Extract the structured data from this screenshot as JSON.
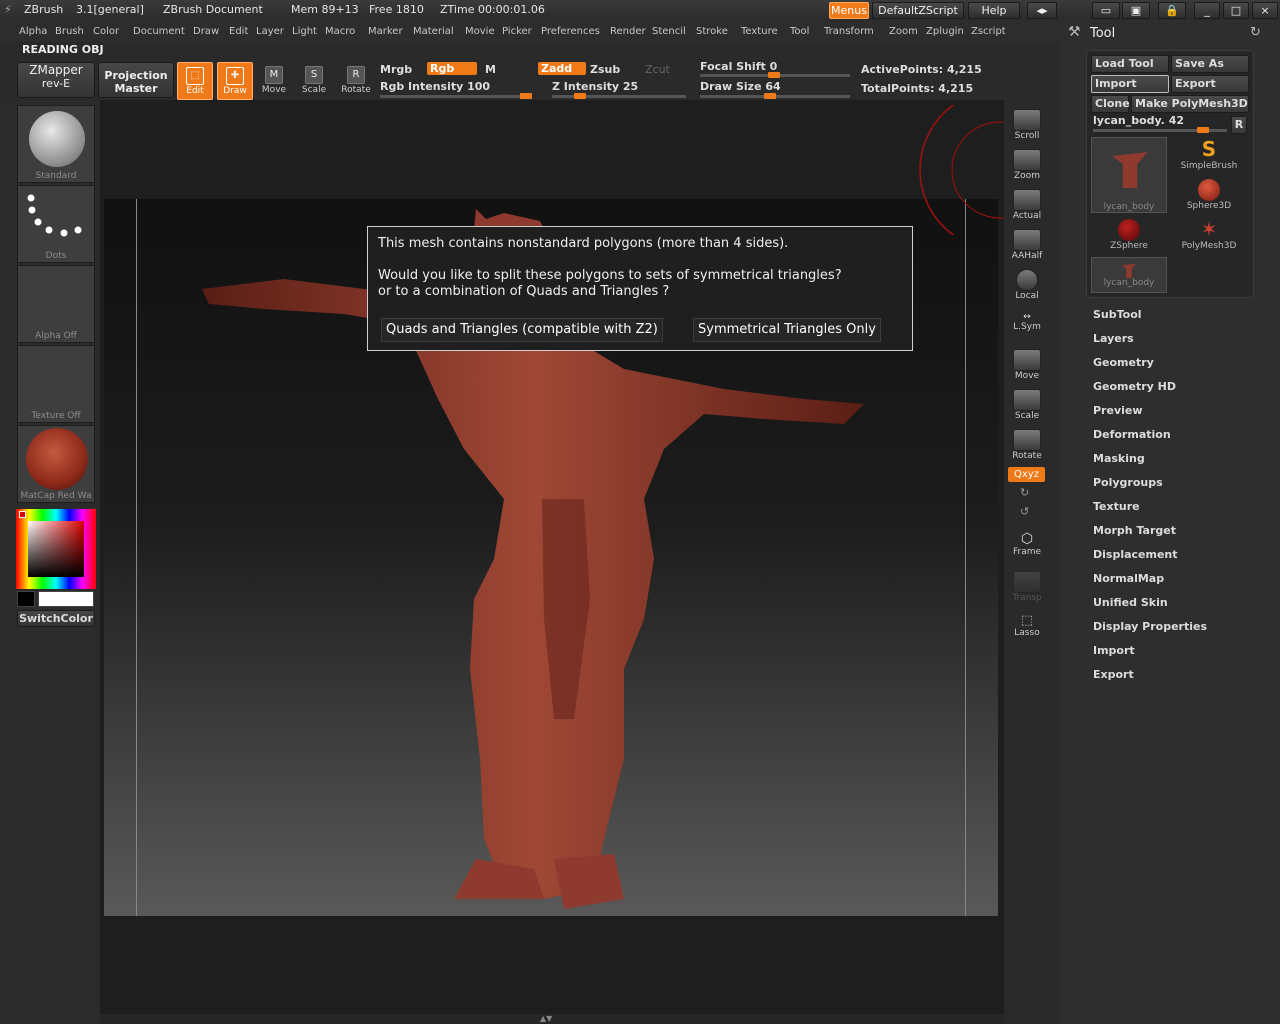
{
  "titlebar": {
    "app": "ZBrush",
    "version": "3.1[general]",
    "document": "ZBrush Document",
    "mem": "Mem 89+13",
    "free": "Free 1810",
    "ztime": "ZTime 00:00:01.06",
    "menus_btn": "Menus",
    "script_btn": "DefaultZScript",
    "help_btn": "Help"
  },
  "menubar": [
    "Alpha",
    "Brush",
    "Color",
    "Document",
    "Draw",
    "Edit",
    "Layer",
    "Light",
    "Macro",
    "Marker",
    "Material",
    "Movie",
    "Picker",
    "Preferences",
    "Render",
    "Stencil",
    "Stroke",
    "Texture",
    "Tool",
    "Transform",
    "Zoom",
    "Zplugin",
    "Zscript"
  ],
  "status_text": "READING OBJ",
  "toolbar": {
    "zmapper": "ZMapper",
    "zmapper_sub": "rev-E",
    "projection": "Projection",
    "projection_sub": "Master",
    "edit": "Edit",
    "draw": "Draw",
    "move": "Move",
    "scale": "Scale",
    "rotate": "Rotate",
    "mrgb": "Mrgb",
    "rgb": "Rgb",
    "m": "M",
    "rgb_intensity": "Rgb Intensity 100",
    "zadd": "Zadd",
    "zsub": "Zsub",
    "zcut": "Zcut",
    "z_intensity": "Z Intensity 25",
    "focal_shift": "Focal Shift 0",
    "draw_size": "Draw Size 64",
    "active_points": "ActivePoints: 4,215",
    "total_points": "TotalPoints: 4,215"
  },
  "left_shelf": {
    "standard": "Standard",
    "dots": "Dots",
    "alpha_off": "Alpha Off",
    "texture_off": "Texture Off",
    "matcap": "MatCap Red Wa",
    "switch_color": "SwitchColor"
  },
  "dialog": {
    "line1": "This mesh contains nonstandard polygons (more than 4 sides).",
    "line2": "Would you like to split these polygons to sets of symmetrical triangles?",
    "line3": "or to a combination of Quads and Triangles ?",
    "btn_quads": "Quads and Triangles (compatible with Z2)",
    "btn_sym": "Symmetrical Triangles Only"
  },
  "right_bar": [
    "Scroll",
    "Zoom",
    "Actual",
    "AAHalf",
    "Local",
    "L.Sym",
    "Move",
    "Scale",
    "Rotate",
    "Frame",
    "Transp",
    "Lasso"
  ],
  "right_bar_xyz": "Qxyz",
  "tool_panel": {
    "title": "Tool",
    "load_tool": "Load Tool",
    "save_as": "Save As",
    "import": "Import",
    "export": "Export",
    "clone": "Clone",
    "make_polymesh": "Make PolyMesh3D",
    "current_tool": "lycan_body. 42",
    "r_btn": "R",
    "thumbs": [
      "lycan_body",
      "SimpleBrush",
      "Sphere3D",
      "ZSphere",
      "PolyMesh3D",
      "lycan_body"
    ],
    "menu": [
      "SubTool",
      "Layers",
      "Geometry",
      "Geometry HD",
      "Preview",
      "Deformation",
      "Masking",
      "Polygroups",
      "Texture",
      "Morph Target",
      "Displacement",
      "NormalMap",
      "Unified Skin",
      "Display Properties",
      "Import",
      "Export"
    ]
  },
  "colors": {
    "accent": "#f07a18",
    "model": "#8e3a2e",
    "dialog_bg": "#1f1f1f"
  }
}
